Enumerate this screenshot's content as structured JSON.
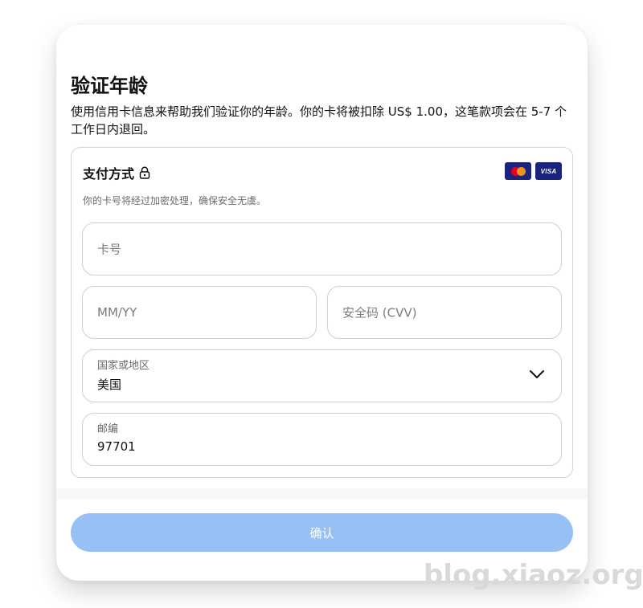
{
  "title": "验证年龄",
  "description": "使用信用卡信息来帮助我们验证你的年龄。你的卡将被扣除 US$ 1.00，这笔款项会在 5-7 个工作日内退回。",
  "payment": {
    "heading": "支付方式",
    "lock_icon": "lock-icon",
    "brands": [
      {
        "name": "mastercard",
        "icon": "mastercard-icon"
      },
      {
        "name": "visa",
        "text": "VISA",
        "icon": "visa-icon"
      }
    ],
    "secure_note": "你的卡号将经过加密处理，确保安全无虞。"
  },
  "form": {
    "card_number": {
      "placeholder": "卡号"
    },
    "expiry": {
      "placeholder": "MM/YY"
    },
    "cvv": {
      "placeholder": "安全码 (CVV)"
    },
    "country": {
      "label": "国家或地区",
      "value": "美国",
      "icon": "chevron-down-icon"
    },
    "postal": {
      "label": "邮编",
      "value": "97701"
    }
  },
  "confirm_label": "确认",
  "watermark": "blog.xiaoz.org",
  "colors": {
    "confirm_button": "#97c1f4",
    "card_brand_bg": "#1a237e",
    "mastercard_red": "#eb001b",
    "mastercard_orange": "#f79e1b"
  }
}
